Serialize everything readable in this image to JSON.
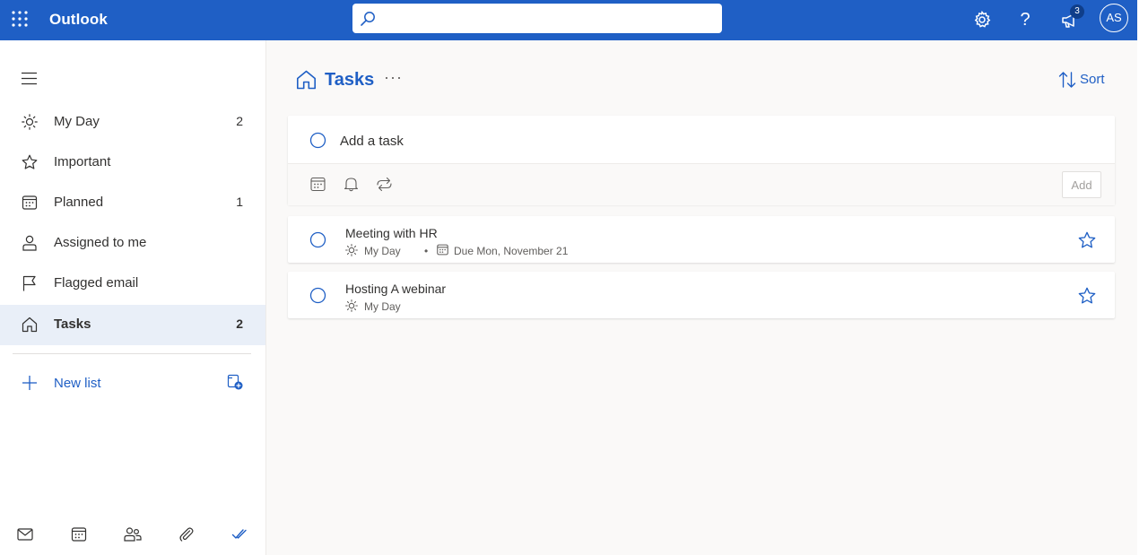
{
  "app": {
    "name": "Outlook",
    "notifications_badge": "3",
    "avatar_initials": "AS",
    "accent_color": "#1f5fc5"
  },
  "search": {
    "value": "",
    "placeholder": ""
  },
  "topbar_icons": [
    "waffle-icon",
    "search-icon",
    "gear-icon",
    "help-icon",
    "megaphone-icon"
  ],
  "help_glyph": "?",
  "sidebar": {
    "items": [
      {
        "label": "My Day",
        "count": "2",
        "icon": "sun-icon"
      },
      {
        "label": "Important",
        "count": "",
        "icon": "star-icon"
      },
      {
        "label": "Planned",
        "count": "1",
        "icon": "calendar-icon"
      },
      {
        "label": "Assigned to me",
        "count": "",
        "icon": "person-icon"
      },
      {
        "label": "Flagged email",
        "count": "",
        "icon": "flag-icon"
      },
      {
        "label": "Tasks",
        "count": "2",
        "icon": "home-icon",
        "selected": true
      }
    ],
    "new_list_label": "New list",
    "bottom_icons": [
      "mail-icon",
      "calendar-icon",
      "people-icon",
      "attachment-icon",
      "todo-check-icon"
    ]
  },
  "main": {
    "title": "Tasks",
    "more_label": "···",
    "sort_label": "Sort",
    "add_task": {
      "placeholder": "Add a task",
      "value": "",
      "add_button_label": "Add"
    },
    "tasks": [
      {
        "title": "Meeting with HR",
        "my_day": "My Day",
        "separator": "•",
        "due": "Due Mon, November 21",
        "starred": false
      },
      {
        "title": "Hosting A webinar",
        "my_day": "My Day",
        "starred": false
      }
    ]
  }
}
